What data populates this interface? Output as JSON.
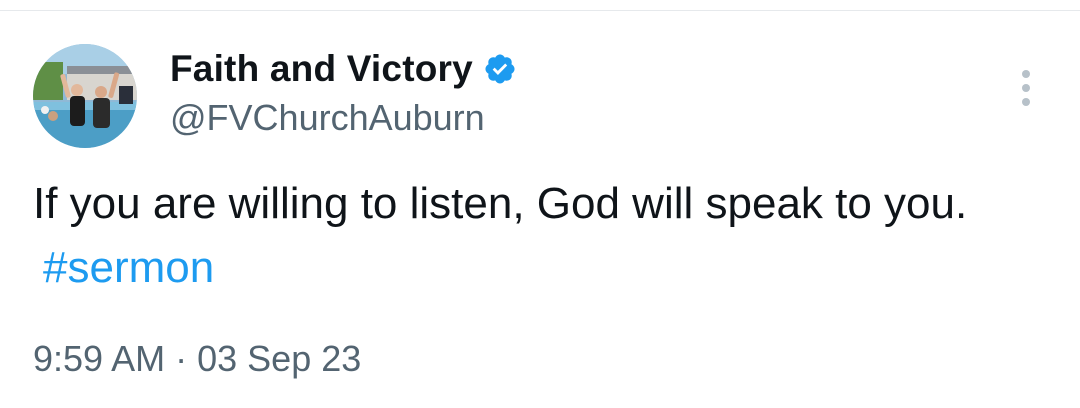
{
  "tweet": {
    "display_name": "Faith and Victory",
    "verified": true,
    "handle": "@FVChurchAuburn",
    "text": "If you are willing to listen, God will speak to you.",
    "hashtag": "#sermon",
    "time": "9:59 AM",
    "separator": "·",
    "date": "03 Sep 23"
  },
  "icons": {
    "verified": "verified-badge-icon",
    "more": "more-vertical-icon"
  },
  "colors": {
    "text": "#0f1419",
    "secondary": "#536471",
    "accent": "#1d9bf0",
    "divider": "#e6e9ec"
  }
}
